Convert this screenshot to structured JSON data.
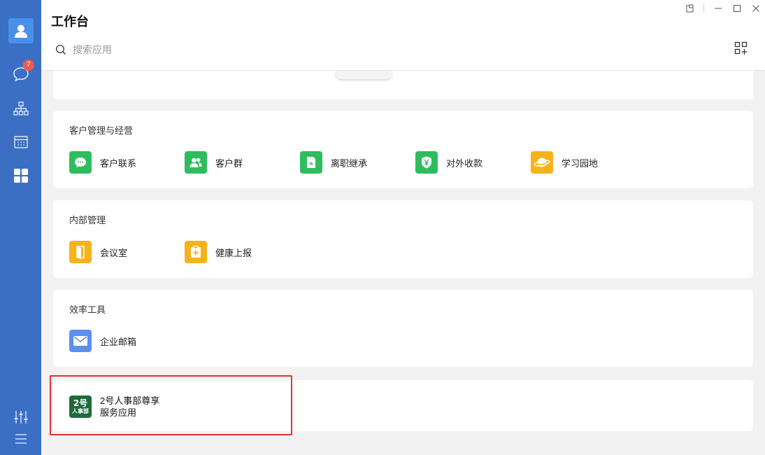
{
  "sidebar": {
    "messages_badge": "7",
    "icons": [
      "user-avatar-icon",
      "chat-icon",
      "org-chart-icon",
      "calendar-icon",
      "apps-grid-icon",
      "settings-sliders-icon",
      "menu-icon"
    ]
  },
  "header": {
    "title": "工作台",
    "search_placeholder": "搜索应用"
  },
  "sections": [
    {
      "title": "客户管理与经营",
      "apps": [
        {
          "label": "客户联系",
          "icon": "chat-bubble-icon",
          "color": "#2ebd5e"
        },
        {
          "label": "客户群",
          "icon": "group-icon",
          "color": "#2ebd5e"
        },
        {
          "label": "离职继承",
          "icon": "transfer-doc-icon",
          "color": "#2ebd5e"
        },
        {
          "label": "对外收款",
          "icon": "yuan-shield-icon",
          "color": "#2ebd5e"
        },
        {
          "label": "学习园地",
          "icon": "planet-icon",
          "color": "#f6b21b"
        }
      ]
    },
    {
      "title": "内部管理",
      "apps": [
        {
          "label": "会议室",
          "icon": "door-icon",
          "color": "#f6b21b"
        },
        {
          "label": "健康上报",
          "icon": "health-report-icon",
          "color": "#f6b21b"
        }
      ]
    },
    {
      "title": "效率工具",
      "apps": [
        {
          "label": "企业邮箱",
          "icon": "mail-icon",
          "color": "#5b8ff0"
        }
      ]
    }
  ],
  "service_app": {
    "line1": "2号人事部尊享",
    "line2": "服务应用",
    "logo_text_top": "2号",
    "logo_text_bottom": "人事部",
    "color": "#1e6b3a"
  }
}
